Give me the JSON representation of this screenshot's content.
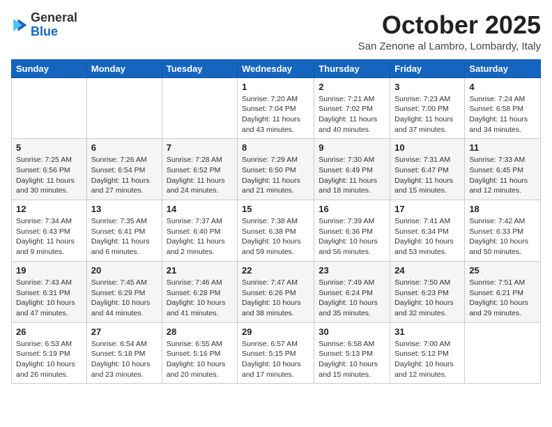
{
  "logo": {
    "line1": "General",
    "line2": "Blue"
  },
  "header": {
    "month": "October 2025",
    "location": "San Zenone al Lambro, Lombardy, Italy"
  },
  "weekdays": [
    "Sunday",
    "Monday",
    "Tuesday",
    "Wednesday",
    "Thursday",
    "Friday",
    "Saturday"
  ],
  "weeks": [
    [
      {
        "day": "",
        "info": ""
      },
      {
        "day": "",
        "info": ""
      },
      {
        "day": "",
        "info": ""
      },
      {
        "day": "1",
        "info": "Sunrise: 7:20 AM\nSunset: 7:04 PM\nDaylight: 11 hours and 43 minutes."
      },
      {
        "day": "2",
        "info": "Sunrise: 7:21 AM\nSunset: 7:02 PM\nDaylight: 11 hours and 40 minutes."
      },
      {
        "day": "3",
        "info": "Sunrise: 7:23 AM\nSunset: 7:00 PM\nDaylight: 11 hours and 37 minutes."
      },
      {
        "day": "4",
        "info": "Sunrise: 7:24 AM\nSunset: 6:58 PM\nDaylight: 11 hours and 34 minutes."
      }
    ],
    [
      {
        "day": "5",
        "info": "Sunrise: 7:25 AM\nSunset: 6:56 PM\nDaylight: 11 hours and 30 minutes."
      },
      {
        "day": "6",
        "info": "Sunrise: 7:26 AM\nSunset: 6:54 PM\nDaylight: 11 hours and 27 minutes."
      },
      {
        "day": "7",
        "info": "Sunrise: 7:28 AM\nSunset: 6:52 PM\nDaylight: 11 hours and 24 minutes."
      },
      {
        "day": "8",
        "info": "Sunrise: 7:29 AM\nSunset: 6:50 PM\nDaylight: 11 hours and 21 minutes."
      },
      {
        "day": "9",
        "info": "Sunrise: 7:30 AM\nSunset: 6:49 PM\nDaylight: 11 hours and 18 minutes."
      },
      {
        "day": "10",
        "info": "Sunrise: 7:31 AM\nSunset: 6:47 PM\nDaylight: 11 hours and 15 minutes."
      },
      {
        "day": "11",
        "info": "Sunrise: 7:33 AM\nSunset: 6:45 PM\nDaylight: 11 hours and 12 minutes."
      }
    ],
    [
      {
        "day": "12",
        "info": "Sunrise: 7:34 AM\nSunset: 6:43 PM\nDaylight: 11 hours and 9 minutes."
      },
      {
        "day": "13",
        "info": "Sunrise: 7:35 AM\nSunset: 6:41 PM\nDaylight: 11 hours and 6 minutes."
      },
      {
        "day": "14",
        "info": "Sunrise: 7:37 AM\nSunset: 6:40 PM\nDaylight: 11 hours and 2 minutes."
      },
      {
        "day": "15",
        "info": "Sunrise: 7:38 AM\nSunset: 6:38 PM\nDaylight: 10 hours and 59 minutes."
      },
      {
        "day": "16",
        "info": "Sunrise: 7:39 AM\nSunset: 6:36 PM\nDaylight: 10 hours and 56 minutes."
      },
      {
        "day": "17",
        "info": "Sunrise: 7:41 AM\nSunset: 6:34 PM\nDaylight: 10 hours and 53 minutes."
      },
      {
        "day": "18",
        "info": "Sunrise: 7:42 AM\nSunset: 6:33 PM\nDaylight: 10 hours and 50 minutes."
      }
    ],
    [
      {
        "day": "19",
        "info": "Sunrise: 7:43 AM\nSunset: 6:31 PM\nDaylight: 10 hours and 47 minutes."
      },
      {
        "day": "20",
        "info": "Sunrise: 7:45 AM\nSunset: 6:29 PM\nDaylight: 10 hours and 44 minutes."
      },
      {
        "day": "21",
        "info": "Sunrise: 7:46 AM\nSunset: 6:28 PM\nDaylight: 10 hours and 41 minutes."
      },
      {
        "day": "22",
        "info": "Sunrise: 7:47 AM\nSunset: 6:26 PM\nDaylight: 10 hours and 38 minutes."
      },
      {
        "day": "23",
        "info": "Sunrise: 7:49 AM\nSunset: 6:24 PM\nDaylight: 10 hours and 35 minutes."
      },
      {
        "day": "24",
        "info": "Sunrise: 7:50 AM\nSunset: 6:23 PM\nDaylight: 10 hours and 32 minutes."
      },
      {
        "day": "25",
        "info": "Sunrise: 7:51 AM\nSunset: 6:21 PM\nDaylight: 10 hours and 29 minutes."
      }
    ],
    [
      {
        "day": "26",
        "info": "Sunrise: 6:53 AM\nSunset: 5:19 PM\nDaylight: 10 hours and 26 minutes."
      },
      {
        "day": "27",
        "info": "Sunrise: 6:54 AM\nSunset: 5:18 PM\nDaylight: 10 hours and 23 minutes."
      },
      {
        "day": "28",
        "info": "Sunrise: 6:55 AM\nSunset: 5:16 PM\nDaylight: 10 hours and 20 minutes."
      },
      {
        "day": "29",
        "info": "Sunrise: 6:57 AM\nSunset: 5:15 PM\nDaylight: 10 hours and 17 minutes."
      },
      {
        "day": "30",
        "info": "Sunrise: 6:58 AM\nSunset: 5:13 PM\nDaylight: 10 hours and 15 minutes."
      },
      {
        "day": "31",
        "info": "Sunrise: 7:00 AM\nSunset: 5:12 PM\nDaylight: 10 hours and 12 minutes."
      },
      {
        "day": "",
        "info": ""
      }
    ]
  ]
}
